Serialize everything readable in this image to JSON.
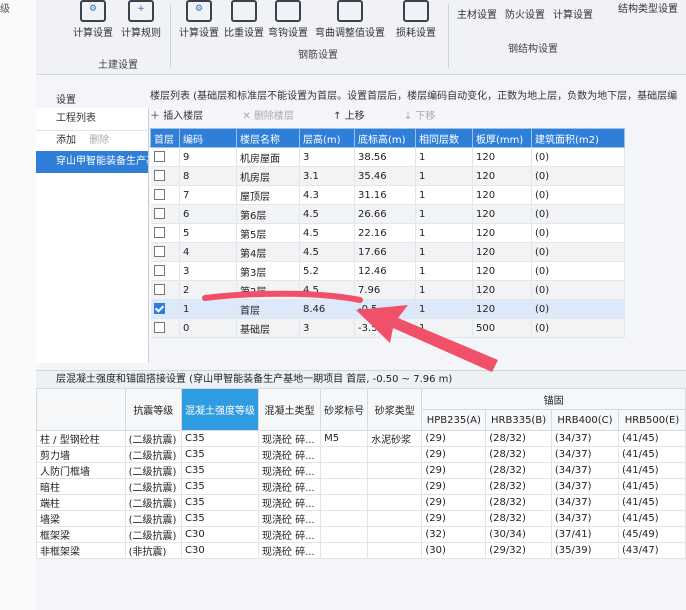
{
  "left_strip": {
    "text": "级"
  },
  "ribbon": {
    "buttons": [
      {
        "label": "计算设置"
      },
      {
        "label": "计算规则"
      },
      {
        "label": "计算设置"
      },
      {
        "label": "比重设置"
      },
      {
        "label": "弯钩设置"
      },
      {
        "label": "弯曲调整值设置"
      },
      {
        "label": "损耗设置"
      },
      {
        "label": "主材设置"
      },
      {
        "label": "防火设置"
      },
      {
        "label": "计算设置"
      },
      {
        "label": "结构类型设置"
      }
    ],
    "groups": {
      "civil": "土建设置",
      "rebar": "钢筋设置",
      "steel": "钢结构设置"
    }
  },
  "settings": {
    "title": "设置",
    "project_list": {
      "header": "工程列表",
      "add": "添加",
      "delete": "删除",
      "selected": "穿山甲智能装备生产基"
    },
    "floor_hint": "楼层列表 (基础层和标准层不能设置为首层。设置首层后，楼层编码自动变化，正数为地上层，负数为地下层，基础层编",
    "toolbar": {
      "insert": "插入楼层",
      "delete": "删除楼层",
      "up": "上移",
      "down": "下移"
    },
    "columns": [
      "首层",
      "编码",
      "楼层名称",
      "层高(m)",
      "底标高(m)",
      "相同层数",
      "板厚(mm)",
      "建筑面积(m2)"
    ],
    "rows": [
      {
        "code": "9",
        "name": "机房屋面",
        "height": "3",
        "bottom": "38.56",
        "same": "1",
        "slab": "120",
        "area": "(0)",
        "checked": false
      },
      {
        "code": "8",
        "name": "机房层",
        "height": "3.1",
        "bottom": "35.46",
        "same": "1",
        "slab": "120",
        "area": "(0)",
        "checked": false
      },
      {
        "code": "7",
        "name": "屋顶层",
        "height": "4.3",
        "bottom": "31.16",
        "same": "1",
        "slab": "120",
        "area": "(0)",
        "checked": false
      },
      {
        "code": "6",
        "name": "第6层",
        "height": "4.5",
        "bottom": "26.66",
        "same": "1",
        "slab": "120",
        "area": "(0)",
        "checked": false
      },
      {
        "code": "5",
        "name": "第5层",
        "height": "4.5",
        "bottom": "22.16",
        "same": "1",
        "slab": "120",
        "area": "(0)",
        "checked": false
      },
      {
        "code": "4",
        "name": "第4层",
        "height": "4.5",
        "bottom": "17.66",
        "same": "1",
        "slab": "120",
        "area": "(0)",
        "checked": false
      },
      {
        "code": "3",
        "name": "第3层",
        "height": "5.2",
        "bottom": "12.46",
        "same": "1",
        "slab": "120",
        "area": "(0)",
        "checked": false
      },
      {
        "code": "2",
        "name": "第2层",
        "height": "4.5",
        "bottom": "7.96",
        "same": "1",
        "slab": "120",
        "area": "(0)",
        "checked": false
      },
      {
        "code": "1",
        "name": "首层",
        "height": "8.46",
        "bottom": "-0.5",
        "same": "1",
        "slab": "120",
        "area": "(0)",
        "checked": true
      },
      {
        "code": "0",
        "name": "基础层",
        "height": "3",
        "bottom": "-3.5",
        "same": "1",
        "slab": "500",
        "area": "(0)",
        "checked": false
      }
    ]
  },
  "concrete": {
    "header": "层混凝土强度和锚固搭接设置 (穿山甲智能装备生产基地一期项目 首层, -0.50 ~ 7.96 m)",
    "anchor_group": "锚固",
    "columns": [
      "",
      "抗震等级",
      "混凝土强度等级",
      "混凝土类型",
      "砂浆标号",
      "砂浆类型",
      "HPB235(A)",
      "HRB335(B)",
      "HRB400(C)",
      "HRB500(E)"
    ],
    "rows": [
      [
        "柱 / 型钢砼柱",
        "(二级抗震)",
        "C35",
        "现浇砼 碎...",
        "M5",
        "水泥砂浆",
        "(29)",
        "(28/32)",
        "(34/37)",
        "(41/45)"
      ],
      [
        "剪力墙",
        "(二级抗震)",
        "C35",
        "现浇砼 碎...",
        "",
        "",
        "(29)",
        "(28/32)",
        "(34/37)",
        "(41/45)"
      ],
      [
        "人防门框墙",
        "(二级抗震)",
        "C35",
        "现浇砼 碎...",
        "",
        "",
        "(29)",
        "(28/32)",
        "(34/37)",
        "(41/45)"
      ],
      [
        "暗柱",
        "(二级抗震)",
        "C35",
        "现浇砼 碎...",
        "",
        "",
        "(29)",
        "(28/32)",
        "(34/37)",
        "(41/45)"
      ],
      [
        "端柱",
        "(二级抗震)",
        "C35",
        "现浇砼 碎...",
        "",
        "",
        "(29)",
        "(28/32)",
        "(34/37)",
        "(41/45)"
      ],
      [
        "墙梁",
        "(二级抗震)",
        "C35",
        "现浇砼 碎...",
        "",
        "",
        "(29)",
        "(28/32)",
        "(34/37)",
        "(41/45)"
      ],
      [
        "框架梁",
        "(二级抗震)",
        "C30",
        "现浇砼 碎...",
        "",
        "",
        "(32)",
        "(30/34)",
        "(37/41)",
        "(45/49)"
      ],
      [
        "非框架梁",
        "(非抗震)",
        "C30",
        "现浇砼 碎...",
        "",
        "",
        "(30)",
        "(29/32)",
        "(35/39)",
        "(43/47)"
      ]
    ]
  }
}
